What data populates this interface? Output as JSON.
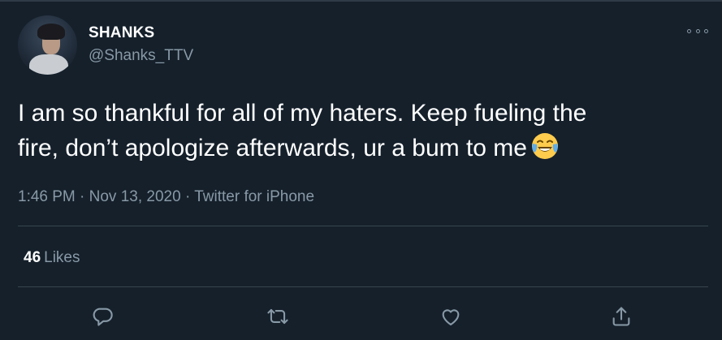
{
  "user": {
    "display_name": "SHANKS",
    "handle": "@Shanks_TTV"
  },
  "tweet": {
    "text_line1": "I am so thankful for all of my haters. Keep fueling the",
    "text_line2": "fire, don’t apologize afterwards, ur a bum to me",
    "emoji": "face-with-tears-of-joy-icon",
    "meta": "1:46 PM · Nov 13, 2020 · Twitter for iPhone"
  },
  "stats": {
    "likes_count": "46",
    "likes_label": "Likes"
  },
  "icons": {
    "more": "more-icon",
    "reply": "reply-icon",
    "retweet": "retweet-icon",
    "like": "heart-icon",
    "share": "share-icon"
  },
  "colors": {
    "background": "#15202b",
    "secondary_text": "#8899a6",
    "divider": "#38444d"
  }
}
